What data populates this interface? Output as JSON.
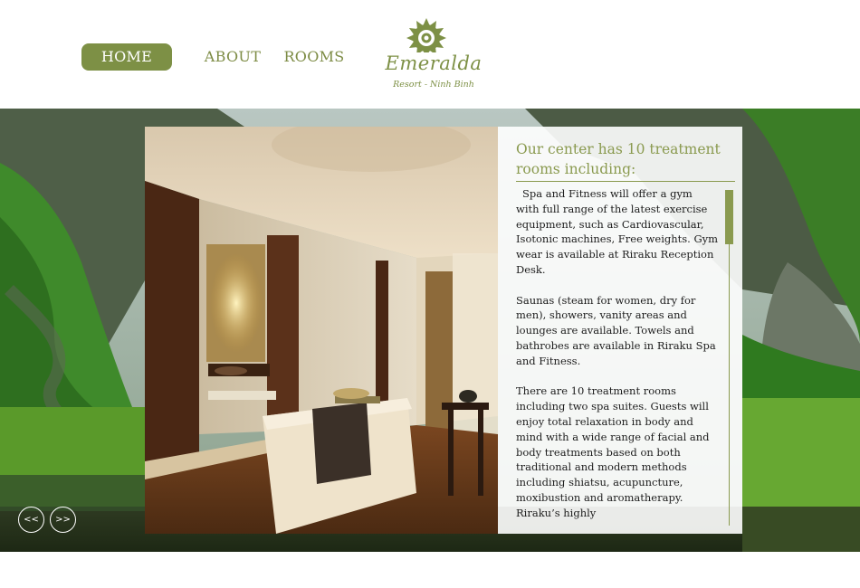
{
  "nav": {
    "home": "HOME",
    "about": "ABOUT",
    "rooms": "ROOMS"
  },
  "logo": {
    "name": "Emeralda",
    "tagline": "Resort - Ninh Binh"
  },
  "panel": {
    "title": "Our center has 10 treatment rooms including:",
    "paragraphs": [
      "Spa and Fitness will offer a gym with full range of the latest exercise equipment, such as Cardiovascular, Isotonic machines, Free weights. Gym wear is available at Riraku Reception Desk.",
      "Saunas (steam for women, dry for men), showers, vanity areas and lounges are available. Towels and bathrobes are available in Riraku Spa and Fitness.",
      "There are 10 treatment rooms including two spa suites. Guests will enjoy total relaxation in body and mind with a wide range of facial and body treatments based on both traditional and modern methods including shiatsu, acupuncture, moxibustion and aromatherapy. Riraku’s highly"
    ]
  },
  "slider": {
    "prev_label": "<<",
    "next_label": ">>"
  },
  "colors": {
    "accent": "#7d9045",
    "text": "#1d1d1d"
  }
}
